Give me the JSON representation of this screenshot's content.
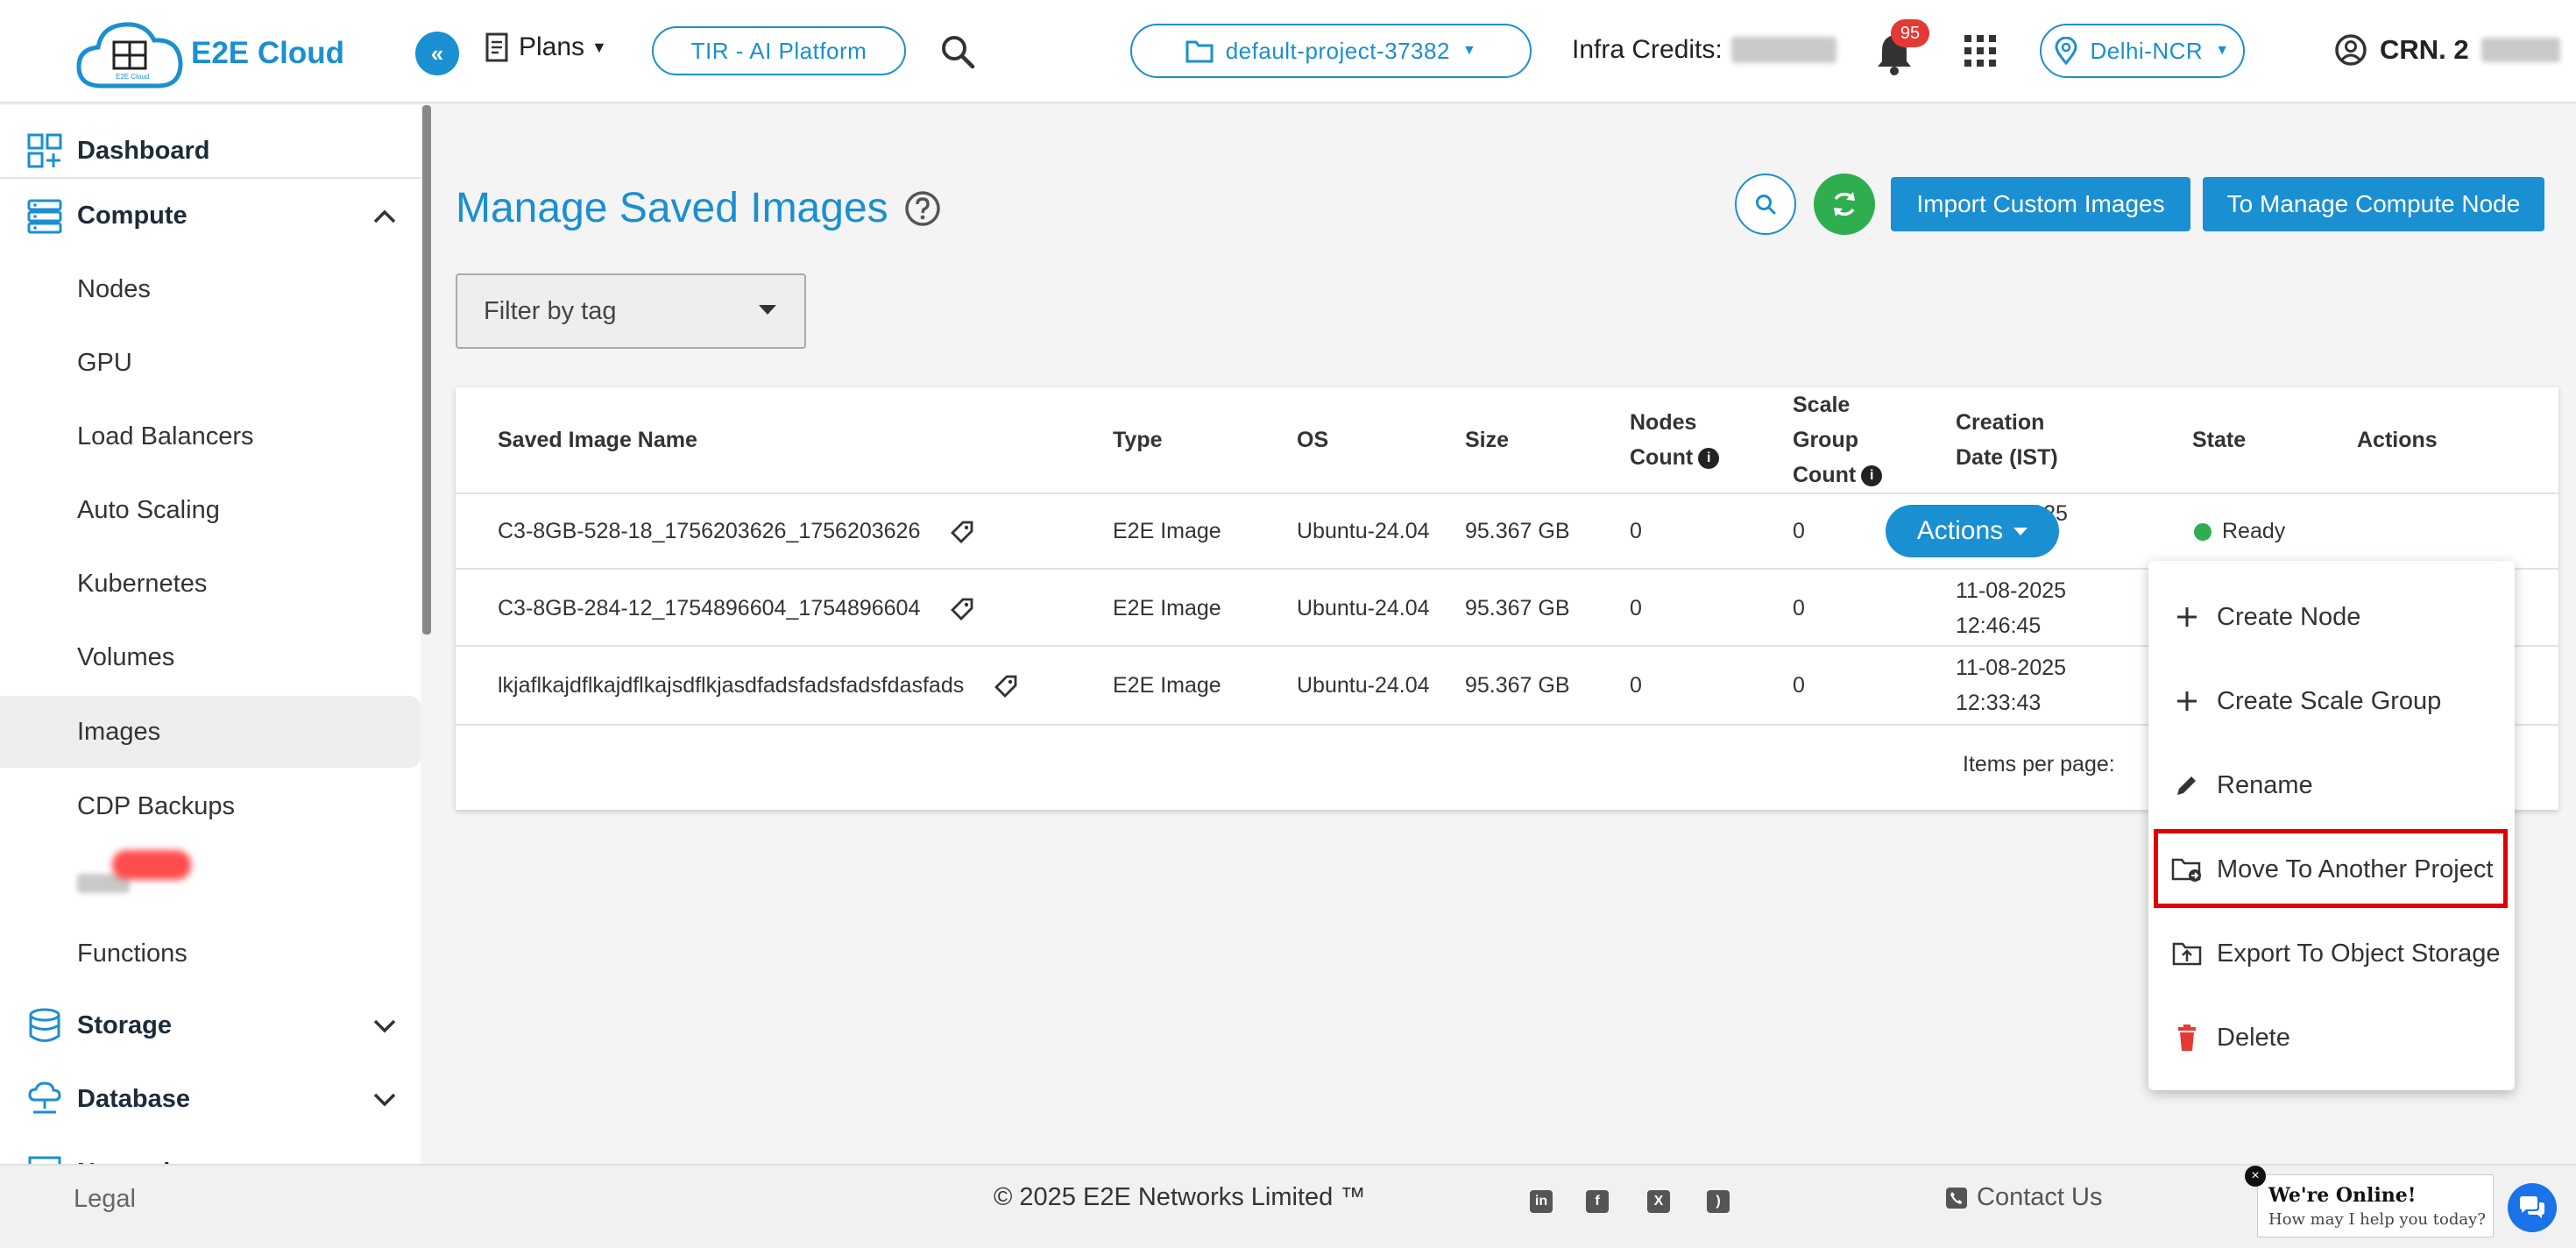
{
  "header": {
    "logo_text": "E2E Cloud",
    "logo_small": "E2E Cloud",
    "plans_label": "Plans",
    "tir_label": "TIR - AI Platform",
    "project_label": "default-project-37382",
    "credits_label": "Infra Credits:",
    "notification_count": "95",
    "region_label": "Delhi-NCR",
    "crn_label": "CRN. 2"
  },
  "sidebar": {
    "dashboard": "Dashboard",
    "compute": "Compute",
    "compute_items": [
      "Nodes",
      "GPU",
      "Load Balancers",
      "Auto Scaling",
      "Kubernetes",
      "Volumes",
      "Images",
      "CDP Backups",
      "Functions"
    ],
    "storage": "Storage",
    "database": "Database",
    "network": "Network"
  },
  "main": {
    "title": "Manage Saved Images",
    "import_button": "Import Custom Images",
    "manage_button": "To Manage Compute Node",
    "filter_placeholder": "Filter by tag",
    "columns": [
      "Saved Image Name",
      "Type",
      "OS",
      "Size",
      "Nodes Count",
      "Scale Group Count",
      "Creation Date (IST)",
      "State",
      "Actions"
    ],
    "rows": [
      {
        "name": "C3-8GB-528-18_1756203626_1756203626",
        "type": "E2E Image",
        "os": "Ubuntu-24.04",
        "size": "95.367 GB",
        "nodes": "0",
        "scale": "0",
        "date": "26-08-2025",
        "time": "15:50:26",
        "state": "Ready"
      },
      {
        "name": "C3-8GB-284-12_1754896604_1754896604",
        "type": "E2E Image",
        "os": "Ubuntu-24.04",
        "size": "95.367 GB",
        "nodes": "0",
        "scale": "0",
        "date": "11-08-2025",
        "time": "12:46:45"
      },
      {
        "name": "lkjaflkajdflkajdflkajsdflkjasdfadsfadsfadsfdasfads",
        "type": "E2E Image",
        "os": "Ubuntu-24.04",
        "size": "95.367 GB",
        "nodes": "0",
        "scale": "0",
        "date": "11-08-2025",
        "time": "12:33:43"
      }
    ],
    "actions_button": "Actions",
    "items_per_page": "Items per page:"
  },
  "menu": {
    "items": [
      "Create Node",
      "Create Scale Group",
      "Rename",
      "Move To Another Project",
      "Export To Object Storage",
      "Delete"
    ]
  },
  "footer": {
    "legal": "Legal",
    "copyright": "© 2025 E2E Networks Limited ™",
    "contact": "Contact Us"
  },
  "chat": {
    "title": "We're Online!",
    "subtitle": "How may I help you today?"
  },
  "colors": {
    "accent": "#1a8fd1",
    "success": "#2eae4f",
    "danger": "#e53935",
    "highlight": "#e00000"
  }
}
